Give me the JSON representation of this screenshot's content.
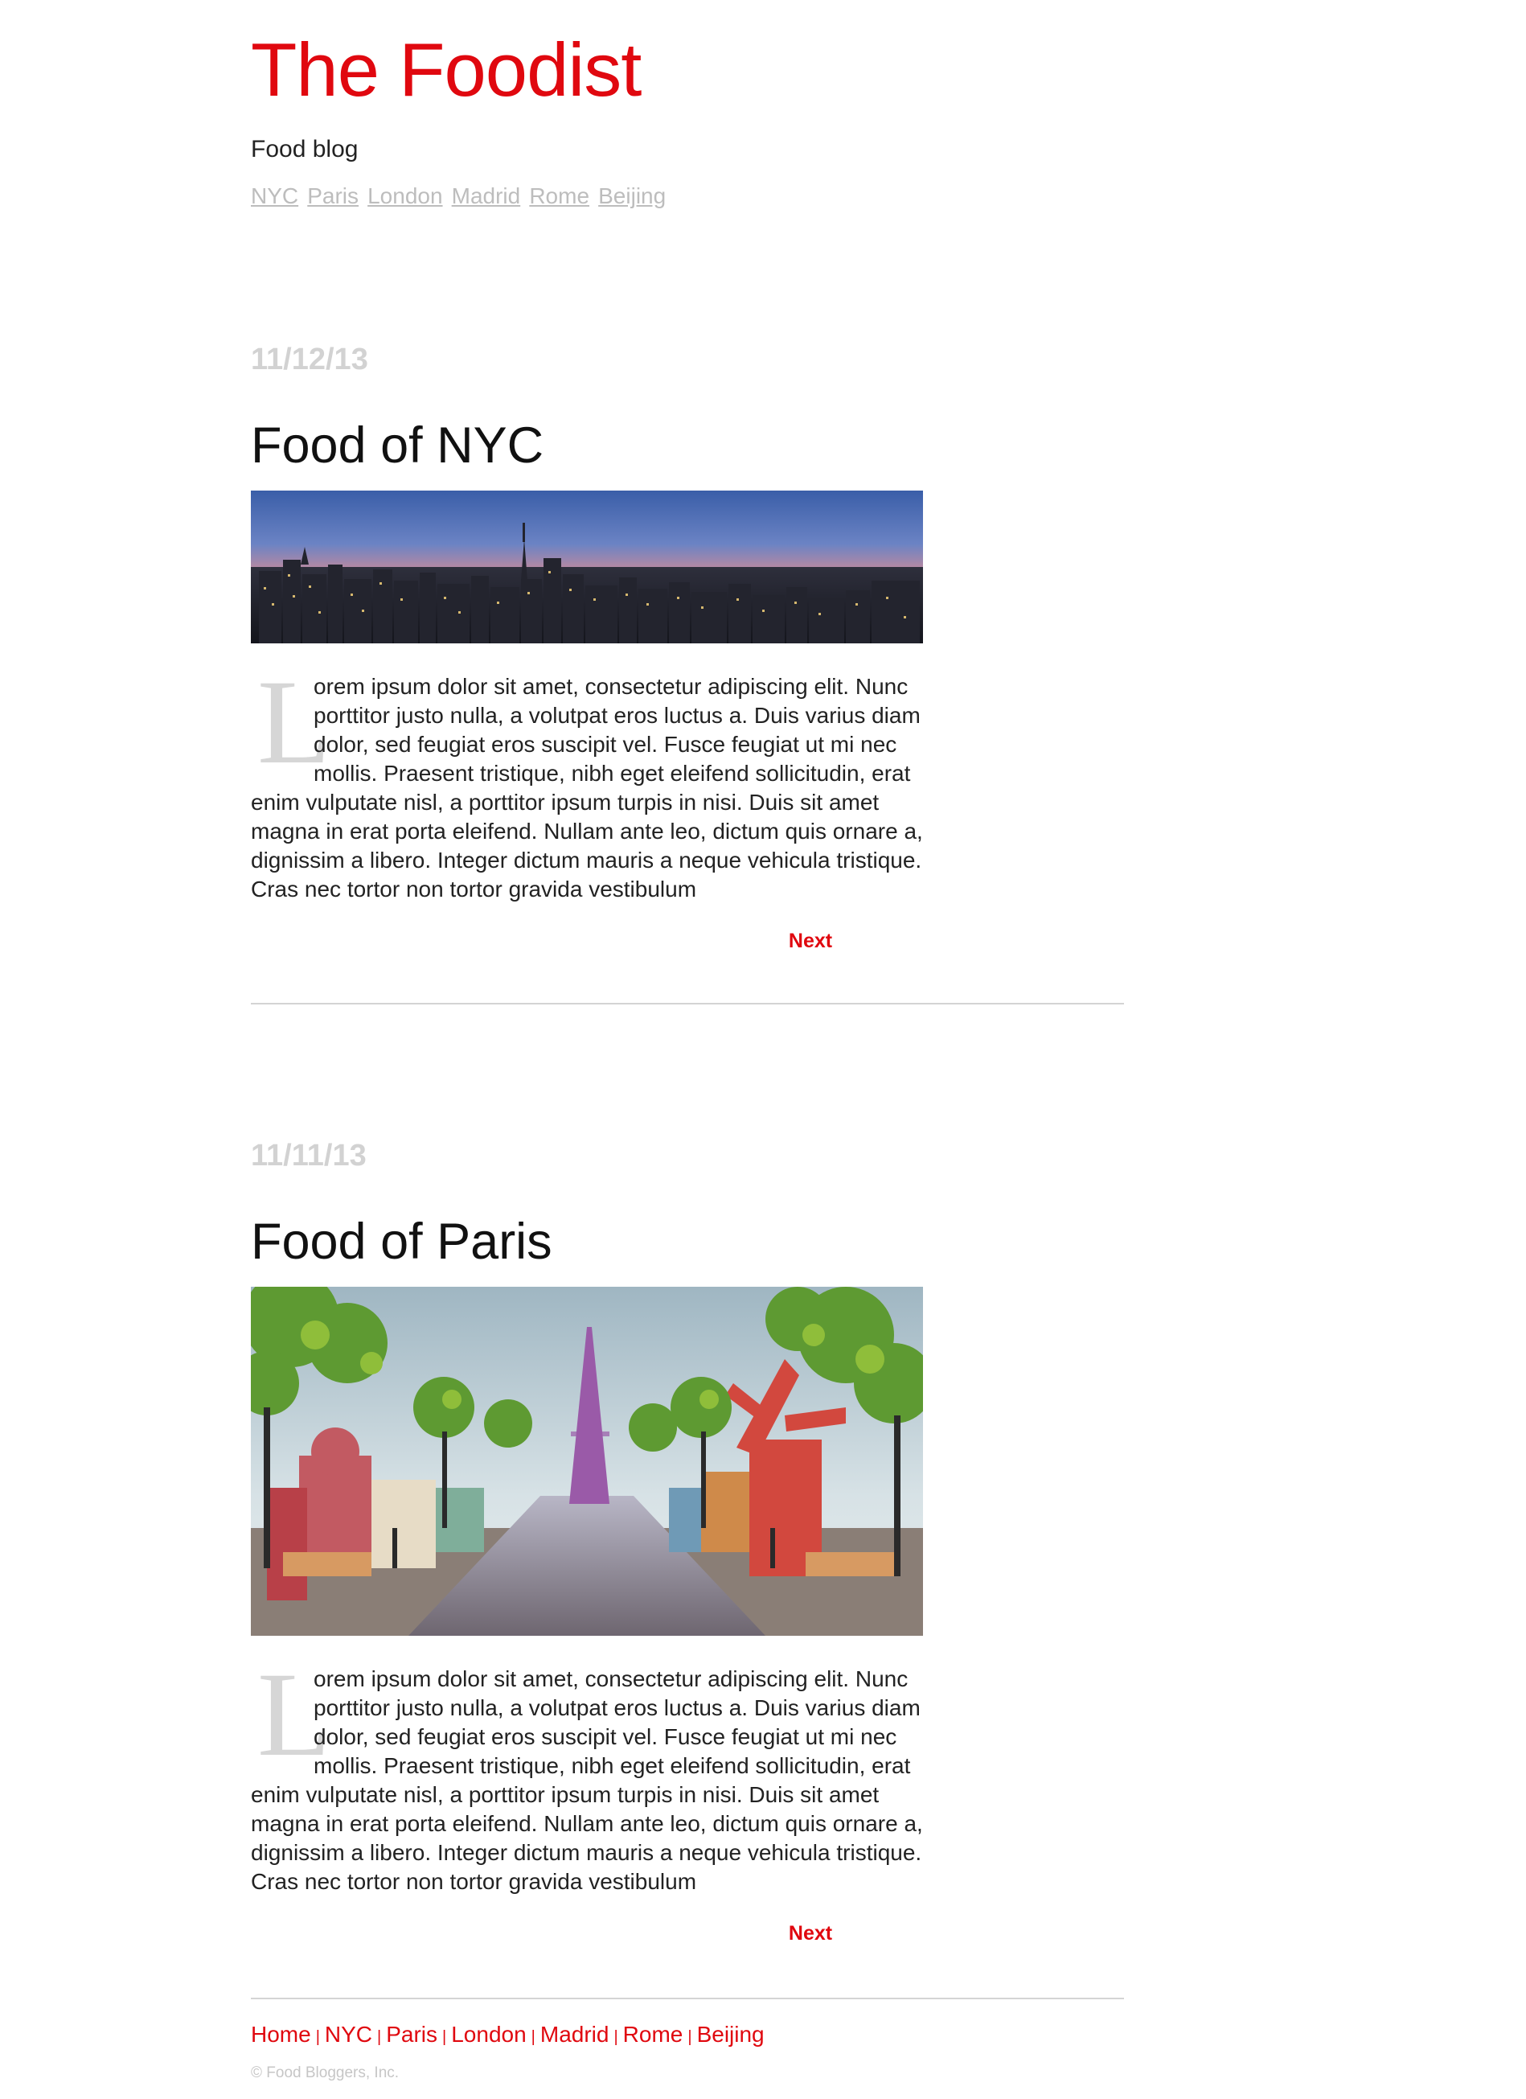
{
  "header": {
    "title": "The Foodist",
    "tagline": "Food blog",
    "nav": [
      "NYC",
      "Paris",
      "London",
      "Madrid",
      "Rome",
      "Beijing"
    ]
  },
  "posts": [
    {
      "date": "11/12/13",
      "title": "Food of NYC",
      "dropcap": "L",
      "body": "orem ipsum dolor sit amet, consectetur adipiscing elit. Nunc porttitor justo nulla, a volutpat eros luctus a. Duis varius diam dolor, sed feugiat eros suscipit vel. Fusce feugiat ut mi nec mollis. Praesent tristique, nibh eget eleifend sollicitudin, erat enim vulputate nisl, a porttitor ipsum turpis in nisi. Duis sit amet magna in erat porta eleifend. Nullam ante leo, dictum quis ornare a, dignissim a libero. Integer dictum mauris a neque vehicula tristique. Cras nec tortor non tortor gravida vestibulum",
      "next_label": "Next",
      "image": "new-york-skyline-at-dusk"
    },
    {
      "date": "11/11/13",
      "title": "Food of Paris",
      "dropcap": "L",
      "body": "orem ipsum dolor sit amet, consectetur adipiscing elit. Nunc porttitor justo nulla, a volutpat eros luctus a. Duis varius diam dolor, sed feugiat eros suscipit vel. Fusce feugiat ut mi nec mollis. Praesent tristique, nibh eget eleifend sollicitudin, erat enim vulputate nisl, a porttitor ipsum turpis in nisi. Duis sit amet magna in erat porta eleifend. Nullam ante leo, dictum quis ornare a, dignissim a libero. Integer dictum mauris a neque vehicula tristique. Cras nec tortor non tortor gravida vestibulum",
      "next_label": "Next",
      "image": "paris-made-of-food-eiffel-tower"
    }
  ],
  "footer": {
    "nav": [
      "Home",
      "NYC",
      "Paris",
      "London",
      "Madrid",
      "Rome",
      "Beijing"
    ],
    "separator": "|",
    "copyright": "© Food Bloggers, Inc."
  },
  "colors": {
    "accent": "#e0080f",
    "muted": "#bdbdbd",
    "date": "#d2d2d2",
    "divider": "#d4d4d4"
  }
}
